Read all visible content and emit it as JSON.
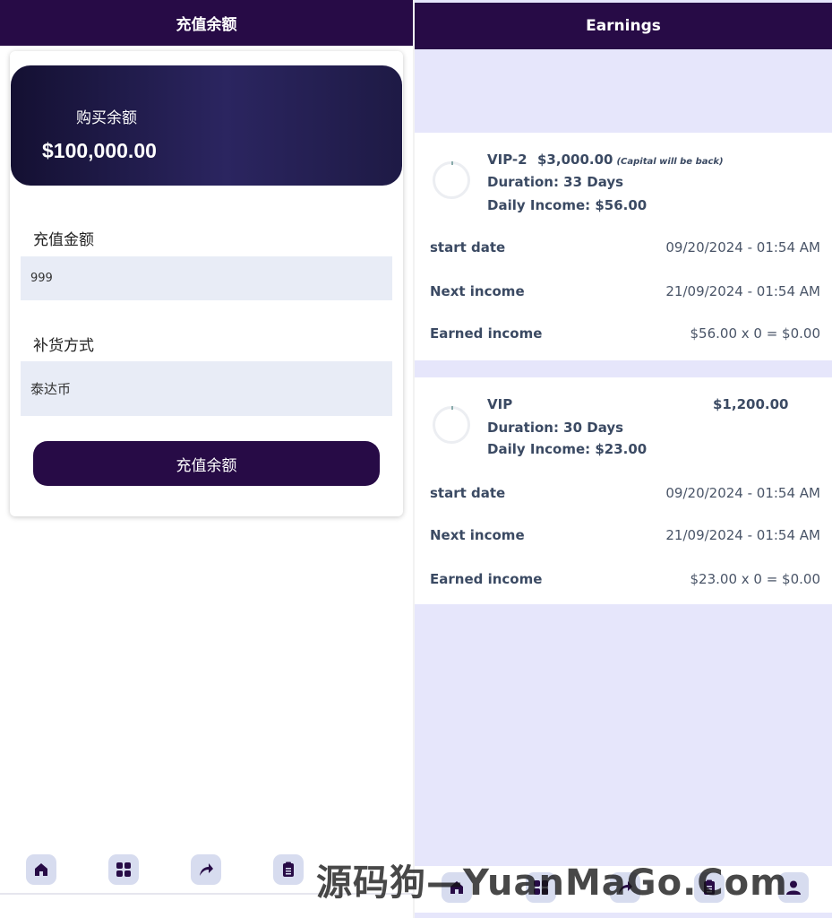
{
  "left": {
    "header_title": "充值余额",
    "balance_label": "购买余额",
    "balance_value": "$100,000.00",
    "amount_label": "充值金额",
    "amount_value": "999",
    "method_label": "补货方式",
    "method_value": "泰达币",
    "submit_label": "充值余额"
  },
  "right": {
    "header_title": "Earnings",
    "cards": [
      {
        "plan": "VIP-2",
        "amount": "$3,000.00",
        "note": "(Capital will be back)",
        "duration": "Duration: 33 Days",
        "daily": "Daily Income: $56.00",
        "start_label": "start date",
        "start_value": "09/20/2024 - 01:54 AM",
        "next_label": "Next income",
        "next_value": "21/09/2024 - 01:54 AM",
        "earned_label": "Earned income",
        "earned_value": "$56.00 x 0 = $0.00"
      },
      {
        "plan": "VIP",
        "amount": "$1,200.00",
        "note": "",
        "duration": "Duration: 30 Days",
        "daily": "Daily Income: $23.00",
        "start_label": "start date",
        "start_value": "09/20/2024 - 01:54 AM",
        "next_label": "Next income",
        "next_value": "21/09/2024 - 01:54 AM",
        "earned_label": "Earned income",
        "earned_value": "$23.00 x 0 = $0.00"
      }
    ]
  },
  "nav_icons": [
    "home-icon",
    "grid-icon",
    "share-arrow-icon",
    "clipboard-icon",
    "user-icon"
  ],
  "watermark": "源码狗—YuanMaGo.Com",
  "colors": {
    "primary": "#270b46",
    "field_bg": "#e8ecf6",
    "page_bg": "#e6e6fb"
  }
}
